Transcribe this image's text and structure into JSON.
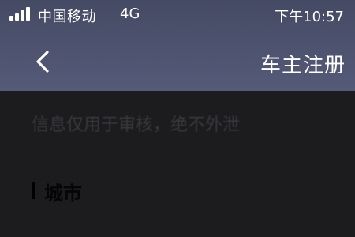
{
  "status_bar": {
    "carrier": "中国移动",
    "network": "4G",
    "time": "下午10:57",
    "signal_bars": 4
  },
  "navbar": {
    "back_icon": "chevron-left-icon",
    "title": "车主注册"
  },
  "content": {
    "notice": "信息仅用于审核，绝不外泄",
    "section_title": "城市"
  },
  "colors": {
    "header_background": "#4d5270",
    "page_background": "#1c1c1f",
    "header_text": "#ffffff"
  }
}
